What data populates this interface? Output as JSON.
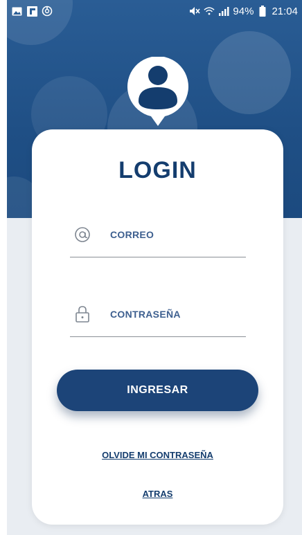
{
  "status_bar": {
    "left_icons": [
      "image-icon",
      "flipboard-icon",
      "sync-icon"
    ],
    "right_icons": [
      "mute-icon",
      "wifi-icon",
      "signal-icon",
      "battery-icon"
    ],
    "battery": "94%",
    "time": "21:04"
  },
  "colors": {
    "header_blue": "#1f4f85",
    "primary_dark": "#143d6e",
    "button": "#1c4478",
    "label_blue": "#3d5f8f",
    "background_gray": "#e9edf2"
  },
  "avatar": {
    "icon": "user-pin-icon"
  },
  "login": {
    "title": "LOGIN",
    "email_label": "CORREO",
    "email_icon": "at-icon",
    "password_label": "CONTRASEÑA",
    "password_icon": "lock-icon",
    "submit_label": "INGRESAR",
    "forgot_link": "OLVIDE MI CONTRASEÑA",
    "back_link": "ATRAS"
  }
}
